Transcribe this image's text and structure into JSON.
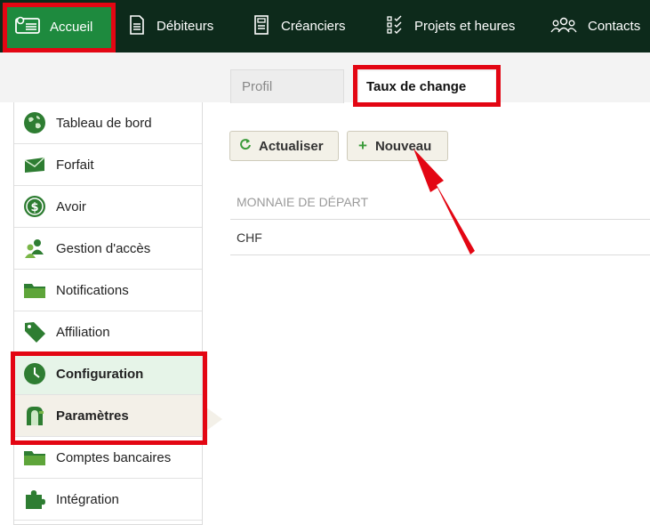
{
  "topnav": {
    "items": [
      {
        "label": "Accueil",
        "icon": "home-dashboard-icon",
        "active": true
      },
      {
        "label": "Débiteurs",
        "icon": "invoice-icon"
      },
      {
        "label": "Créanciers",
        "icon": "bill-icon"
      },
      {
        "label": "Projets et heures",
        "icon": "checklist-icon"
      },
      {
        "label": "Contacts",
        "icon": "people-icon"
      }
    ]
  },
  "tabs": [
    {
      "label": "Profil"
    },
    {
      "label": "Taux de change",
      "active": true
    }
  ],
  "sidebar": {
    "items": [
      {
        "label": "Tableau de bord",
        "icon": "globe-icon"
      },
      {
        "label": "Forfait",
        "icon": "mail-icon"
      },
      {
        "label": "Avoir",
        "icon": "dollar-icon"
      },
      {
        "label": "Gestion d'accès",
        "icon": "users-icon"
      },
      {
        "label": "Notifications",
        "icon": "folder-icon"
      },
      {
        "label": "Affiliation",
        "icon": "tag-icon"
      },
      {
        "label": "Configuration",
        "icon": "clock-icon",
        "state": "active"
      },
      {
        "label": "Paramètres",
        "icon": "mailbox-icon",
        "state": "selected"
      },
      {
        "label": "Comptes bancaires",
        "icon": "folder-icon"
      },
      {
        "label": "Intégration",
        "icon": "puzzle-icon"
      }
    ]
  },
  "toolbar": {
    "refresh_label": "Actualiser",
    "new_label": "Nouveau"
  },
  "table": {
    "columns": [
      "MONNAIE DE DÉPART"
    ],
    "rows": [
      [
        "CHF"
      ]
    ]
  },
  "colors": {
    "nav_bg": "#0d2a1b",
    "nav_active": "#1e8a3e",
    "highlight": "#e30613",
    "icon_green": "#2e7d32"
  }
}
